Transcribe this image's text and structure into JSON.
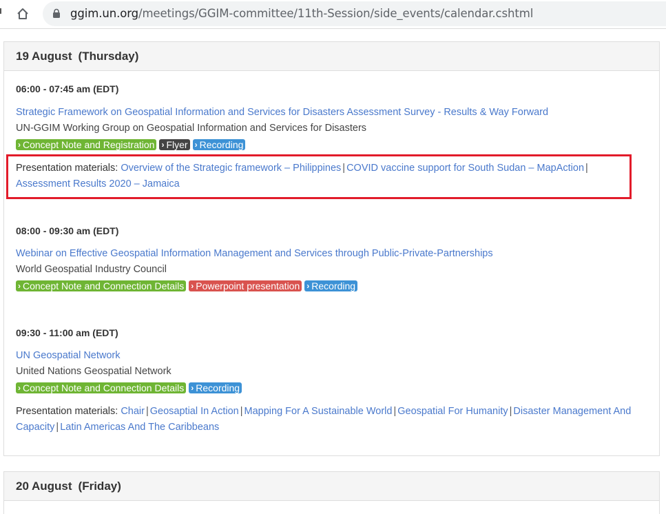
{
  "browser": {
    "url_host": "ggim.un.org",
    "url_path": "/meetings/GGIM-committee/11th-Session/side_events/calendar.cshtml"
  },
  "days": [
    {
      "date": "19 August",
      "weekday": "(Thursday)",
      "events": [
        {
          "time": "06:00 - 07:45 am (EDT)",
          "title": "Strategic Framework on Geospatial Information and Services for Disasters Assessment Survey - Results & Way Forward",
          "organizer": "UN-GGIM Working Group on Geospatial Information and Services for Disasters",
          "tags": [
            {
              "label": "Concept Note and Registration",
              "color": "green"
            },
            {
              "label": "Flyer",
              "color": "dark"
            },
            {
              "label": "Recording",
              "color": "blue"
            }
          ],
          "materials_label": "Presentation materials:",
          "materials": [
            "Overview of the Strategic framework – Philippines",
            "COVID vaccine support for South Sudan – MapAction",
            "Assessment Results 2020 – Jamaica"
          ]
        },
        {
          "time": "08:00 - 09:30 am (EDT)",
          "title": "Webinar on Effective Geospatial Information Management and Services through Public-Private-Partnerships",
          "organizer": "World Geospatial Industry Council",
          "tags": [
            {
              "label": "Concept Note and Connection Details",
              "color": "green"
            },
            {
              "label": "Powerpoint presentation",
              "color": "red"
            },
            {
              "label": "Recording",
              "color": "blue"
            }
          ]
        },
        {
          "time": "09:30 - 11:00 am (EDT)",
          "title": "UN Geospatial Network",
          "organizer": "United Nations Geospatial Network",
          "tags": [
            {
              "label": "Concept Note and Connection Details",
              "color": "green"
            },
            {
              "label": "Recording",
              "color": "blue"
            }
          ],
          "materials_label": "Presentation materials:",
          "materials": [
            "Chair",
            "Geosaptial In Action",
            "Mapping For A Sustainable World",
            "Geospatial For Humanity",
            "Disaster Management And Capacity",
            "Latin Americas And The Caribbeans"
          ]
        }
      ]
    },
    {
      "date": "20 August",
      "weekday": "(Friday)"
    }
  ],
  "colors": {
    "link": "#4a79cc",
    "green_tag": "#6fb534",
    "dark_tag": "#444444",
    "blue_tag": "#3d92d6",
    "red_tag": "#d9534f",
    "highlight_box": "#e21b2a"
  }
}
